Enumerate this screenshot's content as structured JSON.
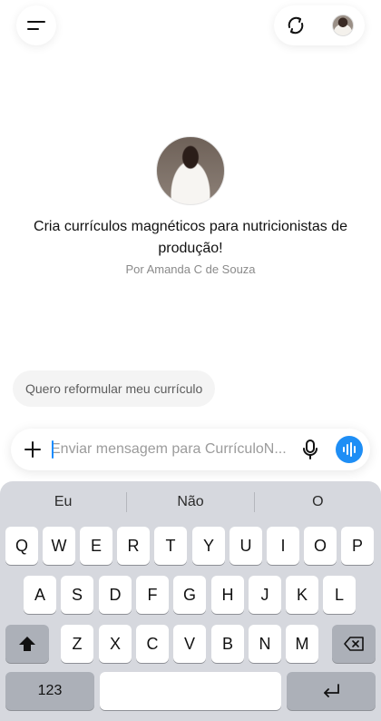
{
  "header": {
    "menu_icon": "menu-icon",
    "refresh_icon": "refresh-chat-icon",
    "avatar_icon": "user-avatar"
  },
  "gpt": {
    "description": "Cria currículos magnéticos para nutricionistas de produção!",
    "author": "Por Amanda C de Souza"
  },
  "suggestion": {
    "label": "Quero reformular meu currículo"
  },
  "composer": {
    "placeholder": "Enviar mensagem para CurrículoN...",
    "value": ""
  },
  "keyboard": {
    "predictions": [
      "Eu",
      "Não",
      "O"
    ],
    "row1": [
      "Q",
      "W",
      "E",
      "R",
      "T",
      "Y",
      "U",
      "I",
      "O",
      "P"
    ],
    "row2": [
      "A",
      "S",
      "D",
      "F",
      "G",
      "H",
      "J",
      "K",
      "L"
    ],
    "row3": [
      "Z",
      "X",
      "C",
      "V",
      "B",
      "N",
      "M"
    ],
    "numbers_label": "123"
  },
  "colors": {
    "accent": "#1e8ef5",
    "keyboard_bg": "#d6d8de"
  }
}
